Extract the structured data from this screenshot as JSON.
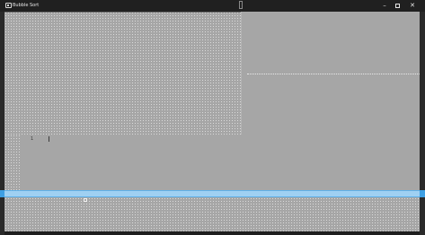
{
  "window": {
    "title": "Bubble Sort",
    "minimize_glyph": "–",
    "close_glyph": "✕"
  },
  "editor": {
    "line_label": "1",
    "cursor_glyph": ""
  },
  "status": {
    "text": ""
  }
}
